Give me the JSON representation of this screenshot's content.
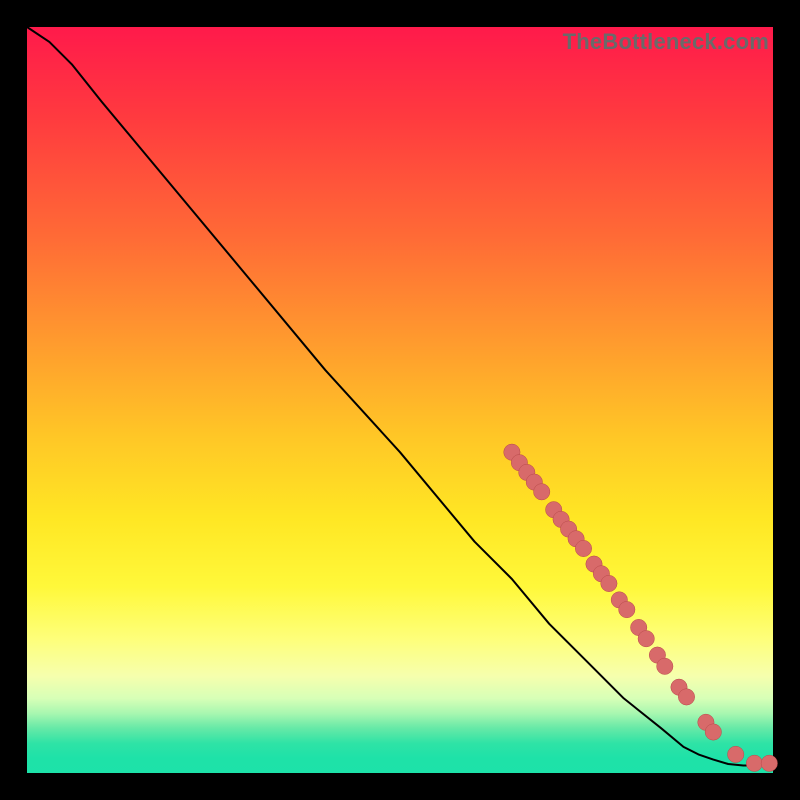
{
  "watermark": "TheBottleneck.com",
  "colors": {
    "marker_fill": "#d86a6a",
    "marker_stroke": "#b84a4a",
    "curve_stroke": "#000000",
    "frame_bg": "#000000"
  },
  "chart_data": {
    "type": "line",
    "title": "",
    "xlabel": "",
    "ylabel": "",
    "xlim": [
      0,
      100
    ],
    "ylim": [
      0,
      100
    ],
    "grid": false,
    "legend": false,
    "series": [
      {
        "name": "curve",
        "x": [
          0,
          3,
          6,
          10,
          15,
          20,
          30,
          40,
          50,
          60,
          65,
          70,
          75,
          80,
          85,
          88,
          90,
          92,
          94,
          96,
          98,
          100
        ],
        "y": [
          100,
          98,
          95,
          90,
          84,
          78,
          66,
          54,
          43,
          31,
          26,
          20,
          15,
          10,
          6,
          3.5,
          2.5,
          1.8,
          1.2,
          1.0,
          1.0,
          1.0
        ]
      }
    ],
    "markers": [
      {
        "x": 65.0,
        "y": 43.0
      },
      {
        "x": 66.0,
        "y": 41.6
      },
      {
        "x": 67.0,
        "y": 40.3
      },
      {
        "x": 68.0,
        "y": 39.0
      },
      {
        "x": 69.0,
        "y": 37.7
      },
      {
        "x": 70.6,
        "y": 35.3
      },
      {
        "x": 71.6,
        "y": 34.0
      },
      {
        "x": 72.6,
        "y": 32.7
      },
      {
        "x": 73.6,
        "y": 31.4
      },
      {
        "x": 74.6,
        "y": 30.1
      },
      {
        "x": 76.0,
        "y": 28.0
      },
      {
        "x": 77.0,
        "y": 26.7
      },
      {
        "x": 78.0,
        "y": 25.4
      },
      {
        "x": 79.4,
        "y": 23.2
      },
      {
        "x": 80.4,
        "y": 21.9
      },
      {
        "x": 82.0,
        "y": 19.5
      },
      {
        "x": 83.0,
        "y": 18.0
      },
      {
        "x": 84.5,
        "y": 15.8
      },
      {
        "x": 85.5,
        "y": 14.3
      },
      {
        "x": 87.4,
        "y": 11.5
      },
      {
        "x": 88.4,
        "y": 10.2
      },
      {
        "x": 91.0,
        "y": 6.8
      },
      {
        "x": 92.0,
        "y": 5.5
      },
      {
        "x": 95.0,
        "y": 2.5
      },
      {
        "x": 97.5,
        "y": 1.3
      },
      {
        "x": 99.5,
        "y": 1.3
      }
    ],
    "marker_radius_percent": 1.1
  }
}
